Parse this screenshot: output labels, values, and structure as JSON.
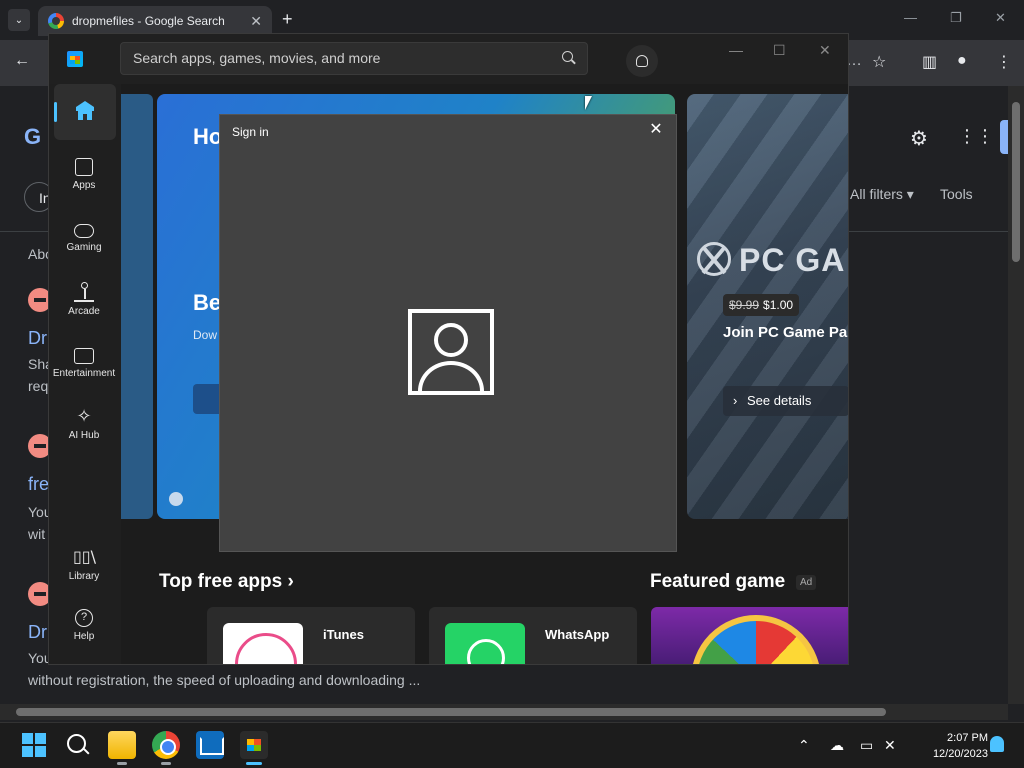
{
  "chrome": {
    "tab_title": "dropmefiles - Google Search",
    "new_tab": "+",
    "google_results": {
      "filters_label": "All filters",
      "tools_label": "Tools",
      "about_prefix": "Abo",
      "chip_prefix": "In",
      "results": [
        {
          "title": "Dr",
          "snippet_line1": "Sha",
          "snippet_line2": "req"
        },
        {
          "title": "fre",
          "snippet_line1": "You",
          "snippet_line2": "wit"
        },
        {
          "title": "Dr",
          "snippet_line1": "You"
        }
      ],
      "bottom_snippet": "without registration, the speed of uploading and downloading ..."
    }
  },
  "store": {
    "search_placeholder": "Search apps, games, movies, and more",
    "nav": [
      {
        "label": "Apps",
        "icon": "apps-icon"
      },
      {
        "label": "Gaming",
        "icon": "gamepad-icon"
      },
      {
        "label": "Arcade",
        "icon": "joystick-icon"
      },
      {
        "label": "Entertainment",
        "icon": "clapperboard-icon"
      },
      {
        "label": "AI Hub",
        "icon": "sparkle-icon"
      },
      {
        "label": "Library",
        "icon": "library-icon"
      },
      {
        "label": "Help",
        "icon": "help-icon"
      }
    ],
    "hero": {
      "title_fragment": "Ho",
      "subtitle_fragment": "Be",
      "desc_fragment": "Dow"
    },
    "promo": {
      "brand": "PC GA",
      "old_price": "$9.99",
      "new_price": "$1.00",
      "headline": "Join PC Game Pa",
      "cta": "See details"
    },
    "sections": {
      "top_free": "Top free apps",
      "top_free_chevron": "›",
      "featured": "Featured game",
      "ad": "Ad"
    },
    "apps": [
      {
        "name": "iTunes"
      },
      {
        "name": "WhatsApp"
      }
    ]
  },
  "dialog": {
    "title": "Sign in",
    "close": "✕"
  },
  "taskbar": {
    "time": "2:07 PM",
    "date": "12/20/2023"
  }
}
